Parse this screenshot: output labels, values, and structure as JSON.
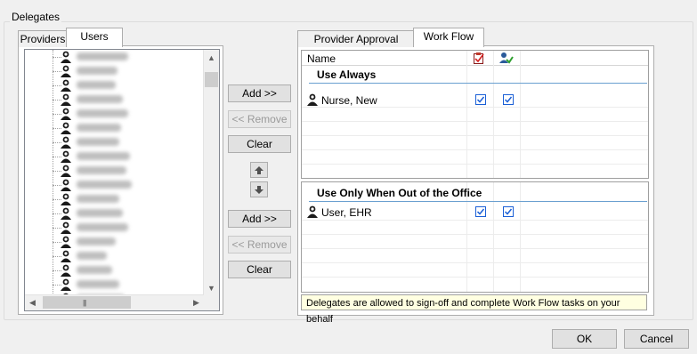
{
  "dialog": {
    "group_title": "Delegates"
  },
  "left_tabs": [
    {
      "label": "Providers"
    },
    {
      "label": "Users"
    }
  ],
  "right_tabs": [
    {
      "label": "Provider Approval Queue"
    },
    {
      "label": "Work Flow"
    }
  ],
  "buttons": {
    "add_top": "Add >>",
    "remove_top": "<< Remove",
    "clear_top": "Clear",
    "add_bottom": "Add >>",
    "remove_bottom": "<< Remove",
    "clear_bottom": "Clear",
    "ok": "OK",
    "cancel": "Cancel"
  },
  "grid": {
    "name_header": "Name",
    "use_always": {
      "title": "Use Always",
      "rows": [
        {
          "name": "Nurse, New",
          "col1_checked": true,
          "col2_checked": true
        }
      ]
    },
    "out_of_office": {
      "title": "Use Only When Out of the Office",
      "rows": [
        {
          "name": "User, EHR",
          "col1_checked": true,
          "col2_checked": true
        }
      ]
    }
  },
  "info_text": "Delegates are allowed to sign-off and complete Work Flow tasks on your behalf",
  "icons": {
    "col1": "task-checklist-icon",
    "col2": "user-check-icon",
    "user": "user-icon"
  },
  "colors": {
    "accent": "#1a5fd6",
    "info_bg": "#ffffe1",
    "user_icon": "#1a1a1a"
  }
}
